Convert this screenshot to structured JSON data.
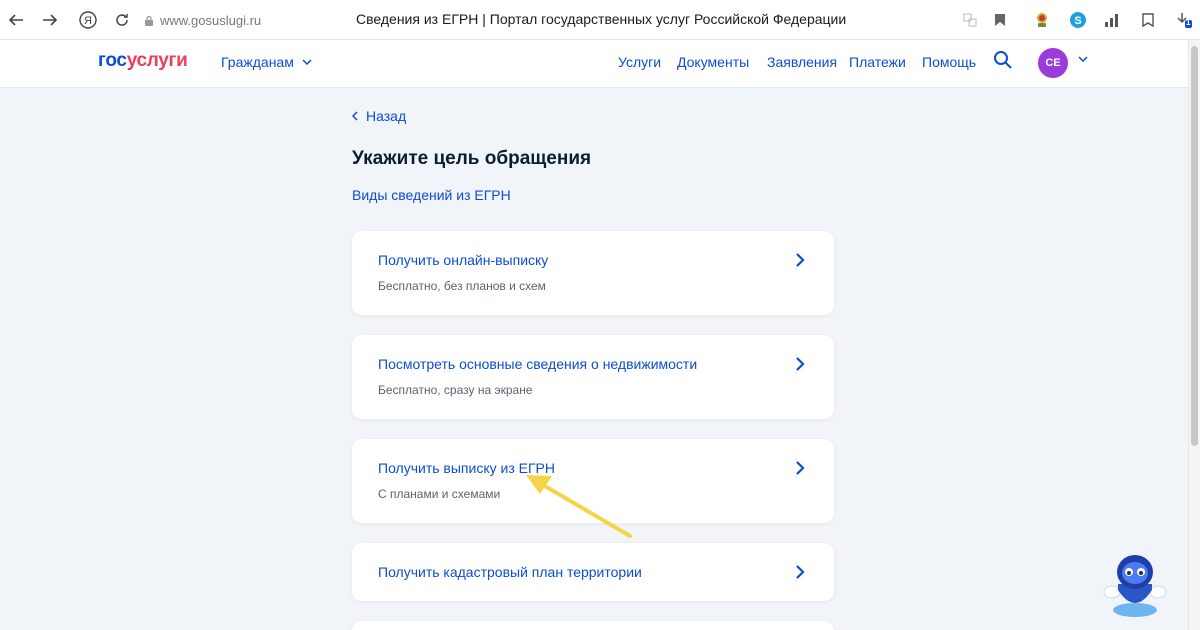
{
  "browser": {
    "url": "www.gosuslugi.ru",
    "tab_title": "Сведения из ЕГРН | Портал государственных услуг Российской Федерации",
    "icons": [
      "back-arrow-icon",
      "forward-arrow-icon",
      "yandex-icon",
      "reload-icon",
      "lock-icon",
      "translate-icon",
      "bookmark-icon",
      "extension-icon",
      "skype-icon",
      "stats-icon",
      "collections-icon",
      "download-icon"
    ],
    "download_badge": "1"
  },
  "header": {
    "logo_part1": "гос",
    "logo_part2": "услуги",
    "citizens": "Гражданам",
    "nav": [
      "Услуги",
      "Документы",
      "Заявления",
      "Платежи",
      "Помощь"
    ],
    "avatar": "СЕ",
    "colors": {
      "accent": "#0d4cd3",
      "logo_red": "#ee3f58",
      "avatar": "#9b3bd9"
    }
  },
  "main": {
    "back": "Назад",
    "title": "Укажите цель обращения",
    "kinds_link": "Виды сведений из ЕГРН",
    "cards": [
      {
        "title": "Получить онлайн-выписку",
        "subtitle": "Бесплатно, без планов и схем"
      },
      {
        "title": "Посмотреть основные сведения о недвижимости",
        "subtitle": "Бесплатно, сразу на экране"
      },
      {
        "title": "Получить выписку из ЕГРН",
        "subtitle": "С планами и схемами"
      },
      {
        "title": "Получить кадастровый план территории",
        "subtitle": ""
      }
    ]
  }
}
